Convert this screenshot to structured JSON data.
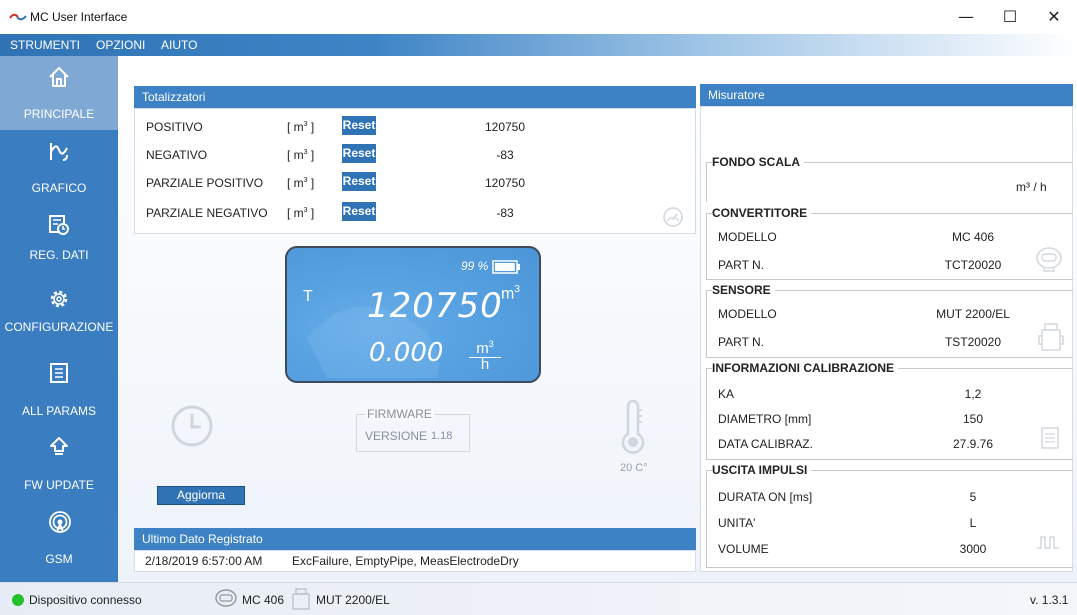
{
  "window": {
    "title": "MC User Interface",
    "minimize": "—",
    "maximize": "☐",
    "close": "✕"
  },
  "menu": [
    "STRUMENTI",
    "OPZIONI",
    "AIUTO"
  ],
  "sidebar": {
    "items": [
      {
        "label": "PRINCIPALE",
        "icon": "home-icon",
        "active": true
      },
      {
        "label": "GRAFICO",
        "icon": "chart-icon",
        "active": false
      },
      {
        "label": "REG. DATI",
        "icon": "datalog-icon",
        "active": false
      },
      {
        "label": "CONFIGURAZIONE",
        "icon": "gear-icon",
        "active": false
      },
      {
        "label": "ALL PARAMS",
        "icon": "list-icon",
        "active": false
      },
      {
        "label": "FW UPDATE",
        "icon": "upload-icon",
        "active": false
      },
      {
        "label": "GSM",
        "icon": "antenna-icon",
        "active": false
      }
    ]
  },
  "totalizzatori": {
    "header": "Totalizzatori",
    "unit_prefix": "[ m",
    "unit_sup": "3",
    "unit_suffix": " ]",
    "reset_label": "Reset",
    "rows": [
      {
        "name": "POSITIVO",
        "value": "120750"
      },
      {
        "name": "NEGATIVO",
        "value": "-83"
      },
      {
        "name": "PARZIALE POSITIVO",
        "value": "120750"
      },
      {
        "name": "PARZIALE NEGATIVO",
        "value": "-83"
      }
    ]
  },
  "lcd": {
    "battery": "99 %",
    "battery_level": 0.99,
    "t_label": "T",
    "total_value": "120750",
    "total_unit": "m",
    "total_unit_sup": "3",
    "flow_value": "0.000",
    "flow_unit_num": "m",
    "flow_unit_num_sup": "3",
    "flow_unit_den": "h"
  },
  "firmware": {
    "title": "FIRMWARE",
    "version_label": "VERSIONE",
    "version_value": "1.18"
  },
  "temperature": "20 C°",
  "aggiorna_label": "Aggiorna",
  "ultimo_dato": {
    "header": "Ultimo Dato Registrato",
    "timestamp": "2/18/2019 6:57:00 AM",
    "message": "ExcFailure, EmptyPipe, MeasElectrodeDry"
  },
  "misuratore": {
    "header": "Misuratore",
    "fondo_scala": {
      "title": "FONDO SCALA",
      "unit": "m³ / h"
    },
    "convertitore": {
      "title": "CONVERTITORE",
      "rows": [
        {
          "key": "MODELLO",
          "value": "MC 406"
        },
        {
          "key": "PART N.",
          "value": "TCT20020"
        }
      ]
    },
    "sensore": {
      "title": "SENSORE",
      "rows": [
        {
          "key": "MODELLO",
          "value": "MUT 2200/EL"
        },
        {
          "key": "PART N.",
          "value": "TST20020"
        }
      ]
    },
    "calibrazione": {
      "title": "INFORMAZIONI CALIBRAZIONE",
      "rows": [
        {
          "key": "KA",
          "value": "1,2"
        },
        {
          "key": "DIAMETRO [mm]",
          "value": "150"
        },
        {
          "key": "DATA CALIBRAZ.",
          "value": "27.9.76"
        }
      ]
    },
    "uscita": {
      "title": "USCITA IMPULSI",
      "rows": [
        {
          "key": "DURATA ON [ms]",
          "value": "5"
        },
        {
          "key": "UNITA'",
          "value": "L"
        },
        {
          "key": "VOLUME",
          "value": "3000"
        }
      ]
    }
  },
  "status": {
    "connection": "Dispositivo connesso",
    "connection_color": "#22c12a",
    "converter": "MC 406",
    "sensor": "MUT 2200/EL",
    "version": "v. 1.3.1"
  }
}
